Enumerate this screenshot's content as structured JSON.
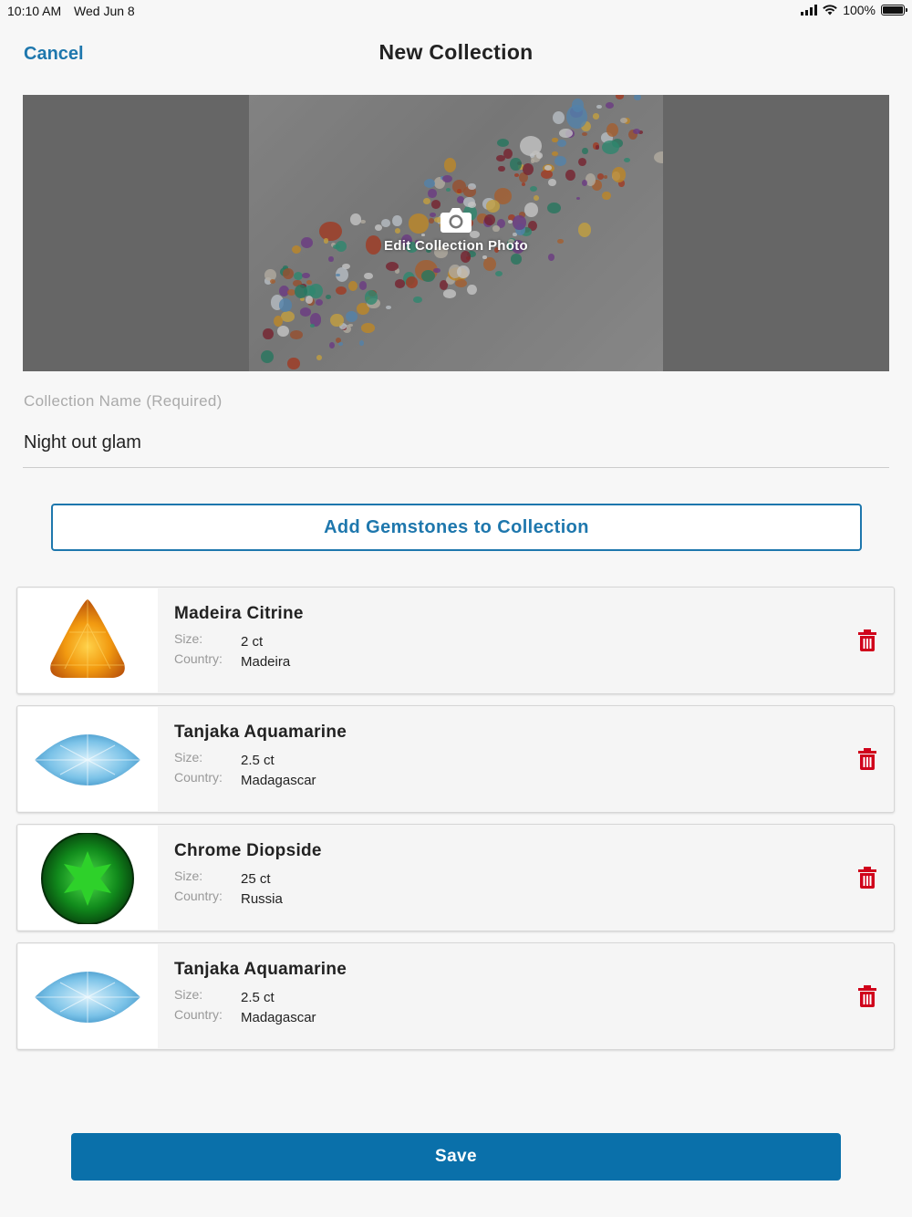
{
  "status_bar": {
    "time": "10:10 AM",
    "date": "Wed Jun 8",
    "battery": "100%"
  },
  "nav": {
    "cancel_label": "Cancel",
    "title": "New Collection"
  },
  "photo": {
    "label": "Edit Collection Photo",
    "icon": "camera-icon"
  },
  "collection_name": {
    "label": "Collection Name (Required)",
    "value": "Night out glam"
  },
  "add_button_label": "Add Gemstones to Collection",
  "gemstones": [
    {
      "name": "Madeira Citrine",
      "size_label": "Size:",
      "size": "2 ct",
      "country_label": "Country:",
      "country": "Madeira",
      "icon": "citrine-gem-icon"
    },
    {
      "name": "Tanjaka Aquamarine",
      "size_label": "Size:",
      "size": "2.5 ct",
      "country_label": "Country:",
      "country": "Madagascar",
      "icon": "aquamarine-gem-icon"
    },
    {
      "name": "Chrome Diopside",
      "size_label": "Size:",
      "size": "25 ct",
      "country_label": "Country:",
      "country": "Russia",
      "icon": "diopside-gem-icon"
    },
    {
      "name": "Tanjaka Aquamarine",
      "size_label": "Size:",
      "size": "2.5 ct",
      "country_label": "Country:",
      "country": "Madagascar",
      "icon": "aquamarine-gem-icon"
    }
  ],
  "save_label": "Save",
  "colors": {
    "accent": "#1e77ad",
    "save_bg": "#0a70aa",
    "delete": "#d0021b"
  }
}
